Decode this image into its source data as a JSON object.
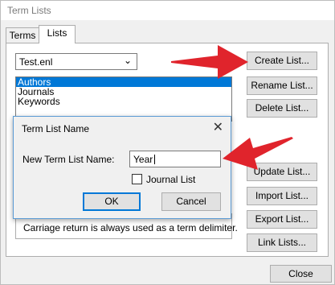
{
  "window": {
    "title": "Term Lists"
  },
  "tabs": [
    {
      "label": "Terms"
    },
    {
      "label": "Lists"
    }
  ],
  "list_select": {
    "value": "Test.enl"
  },
  "lists": [
    {
      "label": "Authors"
    },
    {
      "label": "Journals"
    },
    {
      "label": "Keywords"
    }
  ],
  "buttons": {
    "create": "Create List...",
    "rename": "Rename List...",
    "delete": "Delete List...",
    "update": "Update List...",
    "import": "Import List...",
    "export": "Export List...",
    "link": "Link Lists...",
    "close": "Close"
  },
  "note": "Carriage return is always used as a term delimiter.",
  "dialog": {
    "title": "Term List Name",
    "field_label": "New Term List Name:",
    "field_value": "Year",
    "checkbox_label": "Journal List",
    "ok": "OK",
    "cancel": "Cancel"
  },
  "colors": {
    "highlight": "#0078d7",
    "arrow": "#e0242c"
  }
}
